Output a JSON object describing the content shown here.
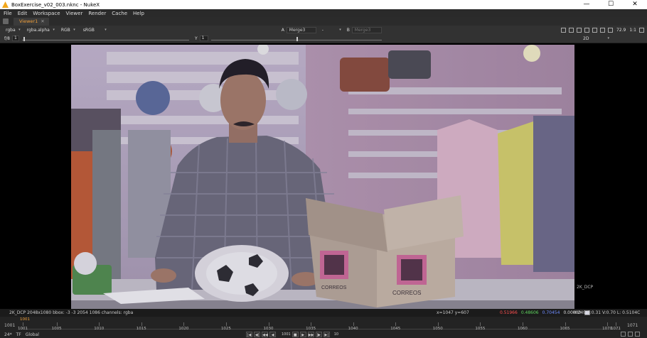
{
  "window": {
    "title": "BoxExercise_v02_003.nknc - NukeX",
    "controls": [
      "—",
      "☐",
      "✕"
    ]
  },
  "menu": [
    "File",
    "Edit",
    "Workspace",
    "Viewer",
    "Render",
    "Cache",
    "Help"
  ],
  "tab": {
    "label": "Viewer1",
    "close": "✕"
  },
  "toolbar": {
    "layer": "rgba",
    "channel": "rgba.alpha",
    "display": "RGB",
    "lut": "sRGB",
    "a_label": "A",
    "a_input": "Merge3",
    "op": "-",
    "b_label": "B",
    "b_input": "Merge3",
    "zoom": "72.9",
    "ratio": "1:1"
  },
  "toolbar2": {
    "fstop": "f/8",
    "gain_value": "1",
    "y_label": "Y",
    "gamma_value": "1",
    "view_mode": "2D"
  },
  "viewer": {
    "format_label": "2K_DCP"
  },
  "infobar": {
    "format": "2K_DCP 2048x1080  bbox: -3 -3 2054 1086 channels: rgba",
    "coords": "x=1047 y=607",
    "r": "0.51966",
    "g": "0.48606",
    "b": "0.70454",
    "a": "0.00000",
    "hsv": "H:249 S:0.31 V:0.70  L: 0.5104C",
    "colors": {
      "r": "#ff5050",
      "g": "#5fd35f",
      "b": "#6f8cff",
      "a": "#dddddd"
    }
  },
  "timeline": {
    "start": "1001",
    "end": "1071",
    "current": "1001",
    "ticks": [
      "1001",
      "1005",
      "1010",
      "1015",
      "1020",
      "1025",
      "1030",
      "1035",
      "1040",
      "1045",
      "1050",
      "1055",
      "1060",
      "1065",
      "1070",
      "1071"
    ],
    "fps": "24*",
    "tf": "TF",
    "range": "Global",
    "frame": "1001",
    "increment": "10",
    "transport": [
      "|◀",
      "◀|",
      "◀◀",
      "◀",
      "■",
      "▶",
      "▶▶",
      "|▶",
      "▶|"
    ]
  }
}
